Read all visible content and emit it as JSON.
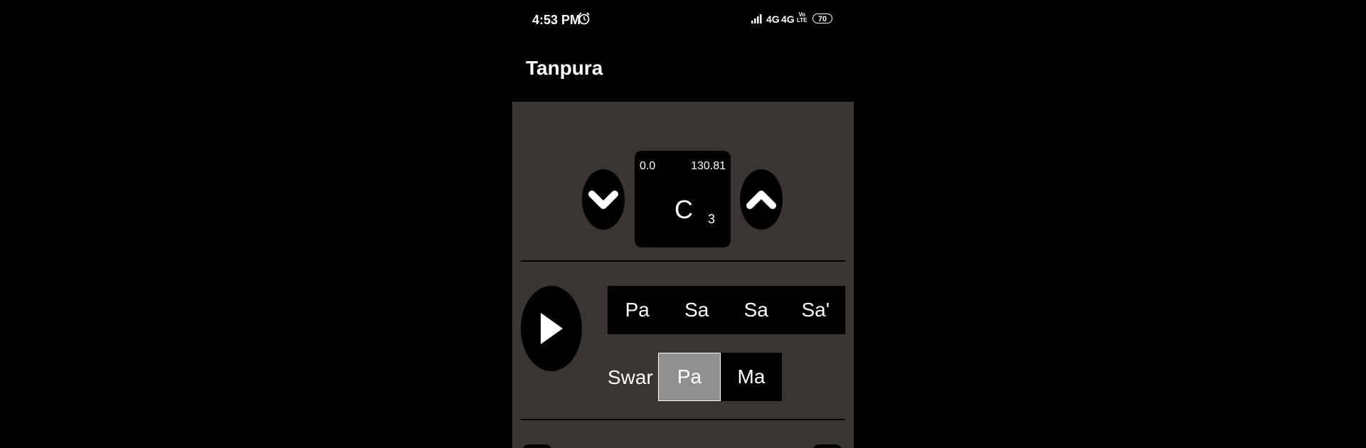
{
  "status_bar": {
    "time": "4:53 PM",
    "network_1": "4G",
    "network_2": "4G",
    "volte_top": "Vo",
    "volte_bottom": "LTE",
    "battery": "70"
  },
  "app_bar": {
    "title": "Tanpura"
  },
  "pitch": {
    "cents": "0.0",
    "frequency": "130.81",
    "note": "C",
    "octave": "3"
  },
  "strings": [
    "Pa",
    "Sa",
    "Sa",
    "Sa'"
  ],
  "swar": {
    "label": "Swar",
    "options": [
      "Pa",
      "Ma"
    ],
    "selected": "Pa"
  },
  "icons": {
    "pitch_down": "chevron-down-icon",
    "pitch_up": "chevron-up-icon",
    "play": "play-icon",
    "alarm": "alarm-icon",
    "signal": "signal-icon"
  },
  "colors": {
    "background": "#000000",
    "content_panel": "#3a3432",
    "selected_option": "#8f8f8f"
  }
}
